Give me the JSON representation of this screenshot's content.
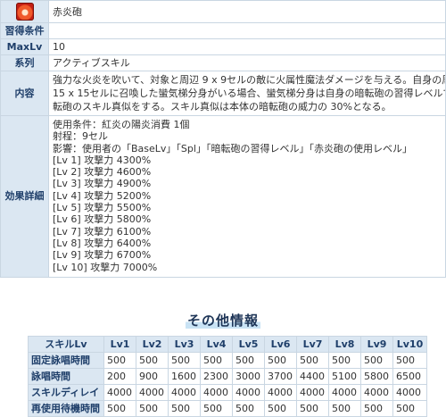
{
  "skill": {
    "name": "赤炎砲",
    "rows": {
      "acquire_label": "習得条件",
      "acquire_value": "",
      "maxlv_label": "MaxLv",
      "maxlv_value": "10",
      "type_label": "系列",
      "type_value": "アクティブスキル",
      "desc_label": "内容",
      "desc_lines": [
        "強力な火炎を吹いて、対象と周辺 9 x 9セルの敵に火属性魔法ダメージを与える。自身の周辺",
        "15 x 15セルに召喚した蠻気梯分身がいる場合、蠻気梯分身は自身の暗転砲の習得レベルで暗",
        "転砲のスキル真似をする。スキル真似は本体の暗転砲の威力の 30%となる。"
      ],
      "detail_label": "効果詳細",
      "detail_lines": [
        "使用条件：紅炎の陽炎消費 1個",
        "射程：9セル",
        "影響：使用者の「BaseLv」「Spl」「暗転砲の習得レベル」「赤炎砲の使用レベル」",
        "[Lv 1] 攻撃力 4300%",
        "[Lv 2] 攻撃力 4600%",
        "[Lv 3] 攻撃力 4900%",
        "[Lv 4] 攻撃力 5200%",
        "[Lv 5] 攻撃力 5500%",
        "[Lv 6] 攻撃力 5800%",
        "[Lv 7] 攻撃力 6100%",
        "[Lv 8] 攻撃力 6400%",
        "[Lv 9] 攻撃力 6700%",
        "[Lv 10] 攻撃力 7000%"
      ]
    }
  },
  "other": {
    "title": "その他情報",
    "header": [
      "スキルLv",
      "Lv1",
      "Lv2",
      "Lv3",
      "Lv4",
      "Lv5",
      "Lv6",
      "Lv7",
      "Lv8",
      "Lv9",
      "Lv10"
    ],
    "rows": [
      {
        "label": "固定詠唱時間",
        "values": [
          "500",
          "500",
          "500",
          "500",
          "500",
          "500",
          "500",
          "500",
          "500",
          "500"
        ]
      },
      {
        "label": "詠唱時間",
        "values": [
          "200",
          "900",
          "1600",
          "2300",
          "3000",
          "3700",
          "4400",
          "5100",
          "5800",
          "6500"
        ]
      },
      {
        "label": "スキルディレイ",
        "values": [
          "4000",
          "4000",
          "4000",
          "4000",
          "4000",
          "4000",
          "4000",
          "4000",
          "4000",
          "4000"
        ]
      },
      {
        "label": "再使用待機時間",
        "values": [
          "500",
          "500",
          "500",
          "500",
          "500",
          "500",
          "500",
          "500",
          "500",
          "500"
        ]
      }
    ]
  },
  "colors": {
    "header_bg": "#dbe7f2",
    "header_text": "#1f3f6a",
    "border": "#c9d6e2",
    "title_highlight": "#c9e3f5"
  },
  "icons": {
    "skill_icon": "fire-skill-icon"
  }
}
